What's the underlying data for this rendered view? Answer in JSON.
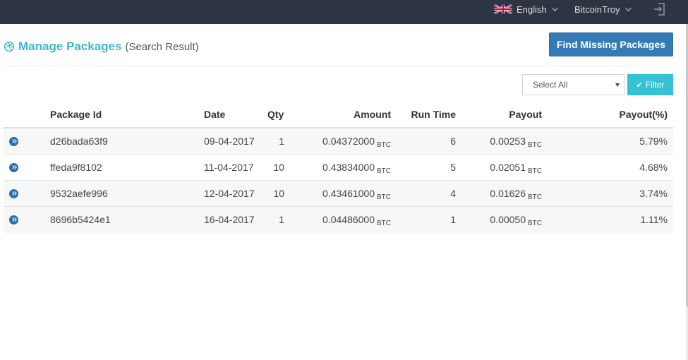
{
  "topbar": {
    "language": "English",
    "username": "BitcoinTroy",
    "flag_icon": "uk-flag-icon",
    "logout_icon": "logout-icon"
  },
  "page": {
    "title": "Manage Packages",
    "subtitle": "(Search Result)",
    "title_icon": "dribbble-icon",
    "accent_color": "#3fb7c6"
  },
  "actions": {
    "find_missing_label": "Find Missing Packages",
    "filter_label": "Filter",
    "filter_select_value": "Select All",
    "primary_color": "#337ab7",
    "filter_color": "#35c2d2"
  },
  "table": {
    "headers": {
      "package_id": "Package Id",
      "date": "Date",
      "qty": "Qty",
      "amount": "Amount",
      "run_time": "Run Time",
      "payout": "Payout",
      "payout_pct": "Payout(%)"
    },
    "unit": "BTC",
    "rows": [
      {
        "package_id": "d26bada63f9",
        "date": "09-04-2017",
        "qty": "1",
        "amount": "0.04372000",
        "run_time": "6",
        "payout": "0.00253",
        "payout_pct": "5.79%"
      },
      {
        "package_id": "ffeda9f8102",
        "date": "11-04-2017",
        "qty": "10",
        "amount": "0.43834000",
        "run_time": "5",
        "payout": "0.02051",
        "payout_pct": "4.68%"
      },
      {
        "package_id": "9532aefe996",
        "date": "12-04-2017",
        "qty": "10",
        "amount": "0.43461000",
        "run_time": "4",
        "payout": "0.01626",
        "payout_pct": "3.74%"
      },
      {
        "package_id": "8696b5424e1",
        "date": "16-04-2017",
        "qty": "1",
        "amount": "0.04486000",
        "run_time": "1",
        "payout": "0.00050",
        "payout_pct": "1.11%"
      }
    ]
  }
}
